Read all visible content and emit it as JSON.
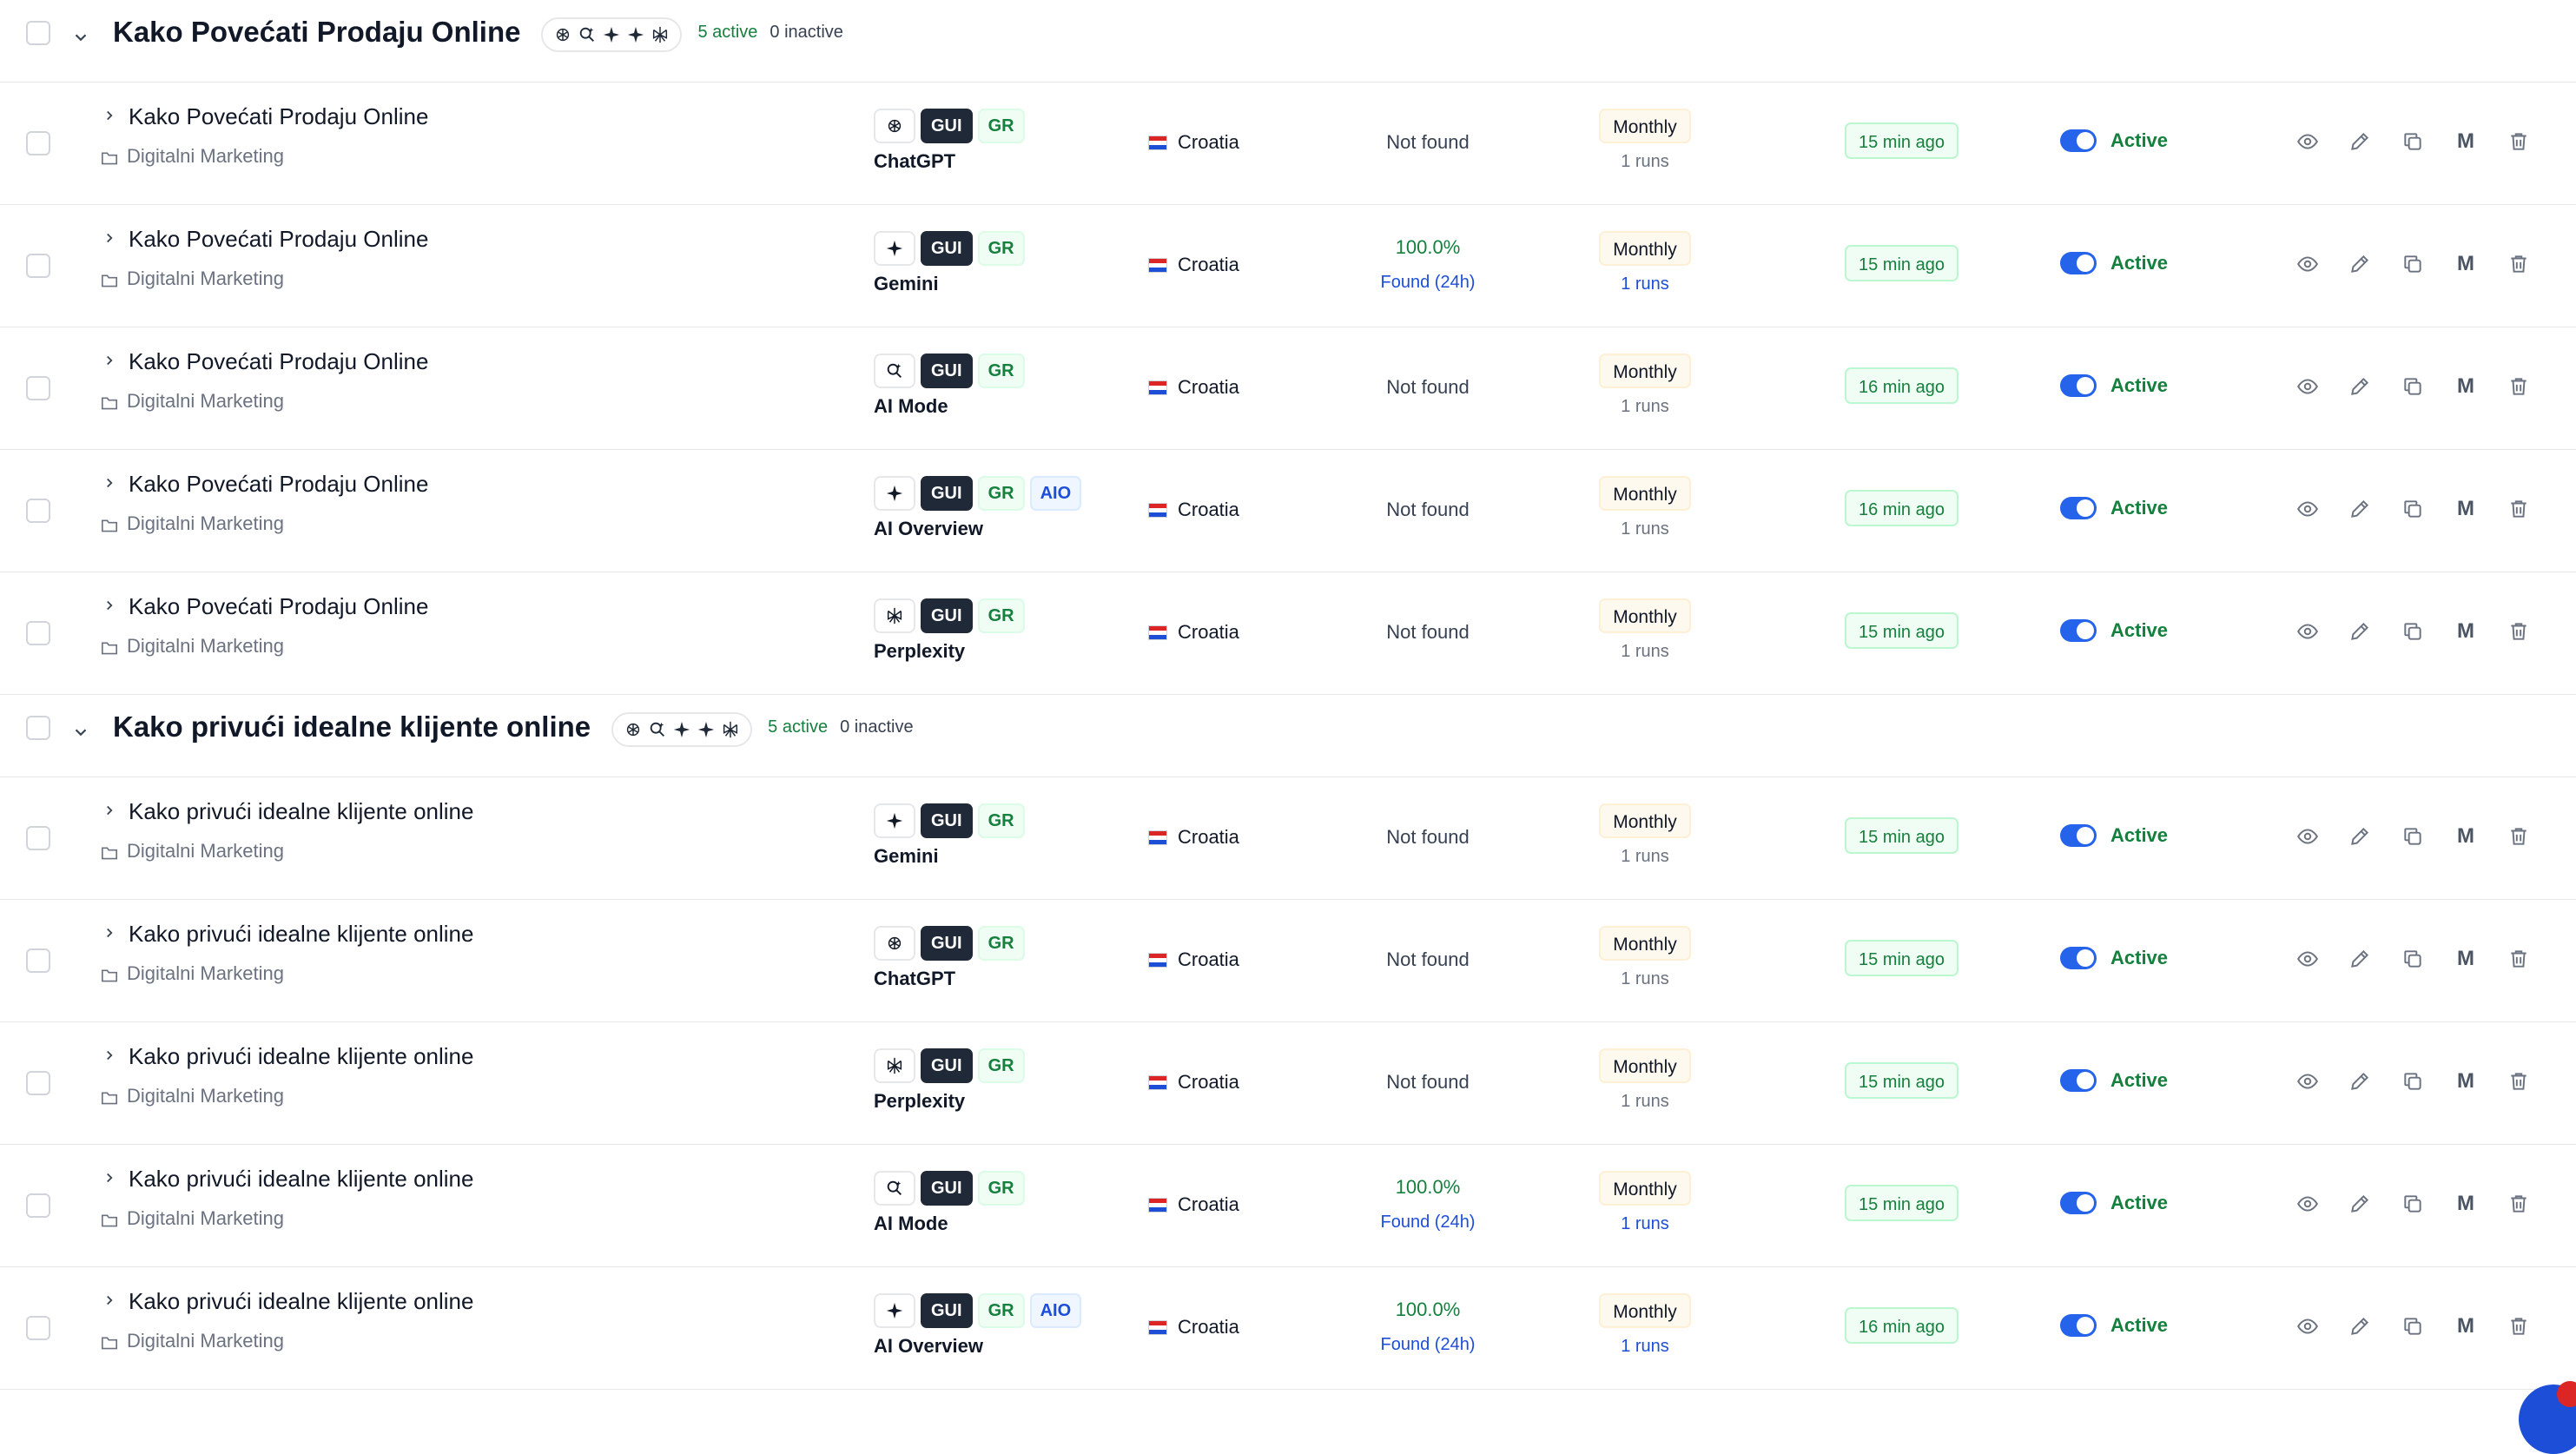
{
  "colors": {
    "active": "#15803d",
    "link": "#1d4ed8",
    "toggle": "#2563eb",
    "gui_badge": "#1f2937"
  },
  "groups": [
    {
      "title": "Kako Povećati Prodaju Online",
      "active_count": "5 active",
      "inactive_count": "0 inactive",
      "engines": [
        "chatgpt-icon",
        "search-sparkle-icon",
        "sparkle-icon",
        "sparkle-icon",
        "perplexity-icon"
      ],
      "rows": [
        {
          "keyword": "Kako Povećati Prodaju Online",
          "folder": "Digitalni Marketing",
          "model_icon": "chatgpt-icon",
          "gui": "GUI",
          "gr": "GR",
          "aio": "",
          "model": "ChatGPT",
          "country": "Croatia",
          "rank": "Not found",
          "rank_found": "",
          "frequency": "Monthly",
          "runs": "1 runs",
          "updated": "15 min ago",
          "status": "Active"
        },
        {
          "keyword": "Kako Povećati Prodaju Online",
          "folder": "Digitalni Marketing",
          "model_icon": "sparkle-icon",
          "gui": "GUI",
          "gr": "GR",
          "aio": "",
          "model": "Gemini",
          "country": "Croatia",
          "rank": "100.0%",
          "rank_found": "Found (24h)",
          "frequency": "Monthly",
          "runs": "1 runs",
          "updated": "15 min ago",
          "status": "Active"
        },
        {
          "keyword": "Kako Povećati Prodaju Online",
          "folder": "Digitalni Marketing",
          "model_icon": "search-sparkle-icon",
          "gui": "GUI",
          "gr": "GR",
          "aio": "",
          "model": "AI Mode",
          "country": "Croatia",
          "rank": "Not found",
          "rank_found": "",
          "frequency": "Monthly",
          "runs": "1 runs",
          "updated": "16 min ago",
          "status": "Active"
        },
        {
          "keyword": "Kako Povećati Prodaju Online",
          "folder": "Digitalni Marketing",
          "model_icon": "sparkle-icon",
          "gui": "GUI",
          "gr": "GR",
          "aio": "AIO",
          "model": "AI Overview",
          "country": "Croatia",
          "rank": "Not found",
          "rank_found": "",
          "frequency": "Monthly",
          "runs": "1 runs",
          "updated": "16 min ago",
          "status": "Active"
        },
        {
          "keyword": "Kako Povećati Prodaju Online",
          "folder": "Digitalni Marketing",
          "model_icon": "perplexity-icon",
          "gui": "GUI",
          "gr": "GR",
          "aio": "",
          "model": "Perplexity",
          "country": "Croatia",
          "rank": "Not found",
          "rank_found": "",
          "frequency": "Monthly",
          "runs": "1 runs",
          "updated": "15 min ago",
          "status": "Active"
        }
      ]
    },
    {
      "title": "Kako privući idealne klijente online",
      "active_count": "5 active",
      "inactive_count": "0 inactive",
      "engines": [
        "chatgpt-icon",
        "search-sparkle-icon",
        "sparkle-icon",
        "sparkle-icon",
        "perplexity-icon"
      ],
      "rows": [
        {
          "keyword": "Kako privući idealne klijente online",
          "folder": "Digitalni Marketing",
          "model_icon": "sparkle-icon",
          "gui": "GUI",
          "gr": "GR",
          "aio": "",
          "model": "Gemini",
          "country": "Croatia",
          "rank": "Not found",
          "rank_found": "",
          "frequency": "Monthly",
          "runs": "1 runs",
          "updated": "15 min ago",
          "status": "Active"
        },
        {
          "keyword": "Kako privući idealne klijente online",
          "folder": "Digitalni Marketing",
          "model_icon": "chatgpt-icon",
          "gui": "GUI",
          "gr": "GR",
          "aio": "",
          "model": "ChatGPT",
          "country": "Croatia",
          "rank": "Not found",
          "rank_found": "",
          "frequency": "Monthly",
          "runs": "1 runs",
          "updated": "15 min ago",
          "status": "Active"
        },
        {
          "keyword": "Kako privući idealne klijente online",
          "folder": "Digitalni Marketing",
          "model_icon": "perplexity-icon",
          "gui": "GUI",
          "gr": "GR",
          "aio": "",
          "model": "Perplexity",
          "country": "Croatia",
          "rank": "Not found",
          "rank_found": "",
          "frequency": "Monthly",
          "runs": "1 runs",
          "updated": "15 min ago",
          "status": "Active"
        },
        {
          "keyword": "Kako privući idealne klijente online",
          "folder": "Digitalni Marketing",
          "model_icon": "search-sparkle-icon",
          "gui": "GUI",
          "gr": "GR",
          "aio": "",
          "model": "AI Mode",
          "country": "Croatia",
          "rank": "100.0%",
          "rank_found": "Found (24h)",
          "frequency": "Monthly",
          "runs": "1 runs",
          "updated": "15 min ago",
          "status": "Active"
        },
        {
          "keyword": "Kako privući idealne klijente online",
          "folder": "Digitalni Marketing",
          "model_icon": "sparkle-icon",
          "gui": "GUI",
          "gr": "GR",
          "aio": "AIO",
          "model": "AI Overview",
          "country": "Croatia",
          "rank": "100.0%",
          "rank_found": "Found (24h)",
          "frequency": "Monthly",
          "runs": "1 runs",
          "updated": "16 min ago",
          "status": "Active"
        }
      ]
    }
  ],
  "row_actions": {
    "memo_label": "M"
  }
}
